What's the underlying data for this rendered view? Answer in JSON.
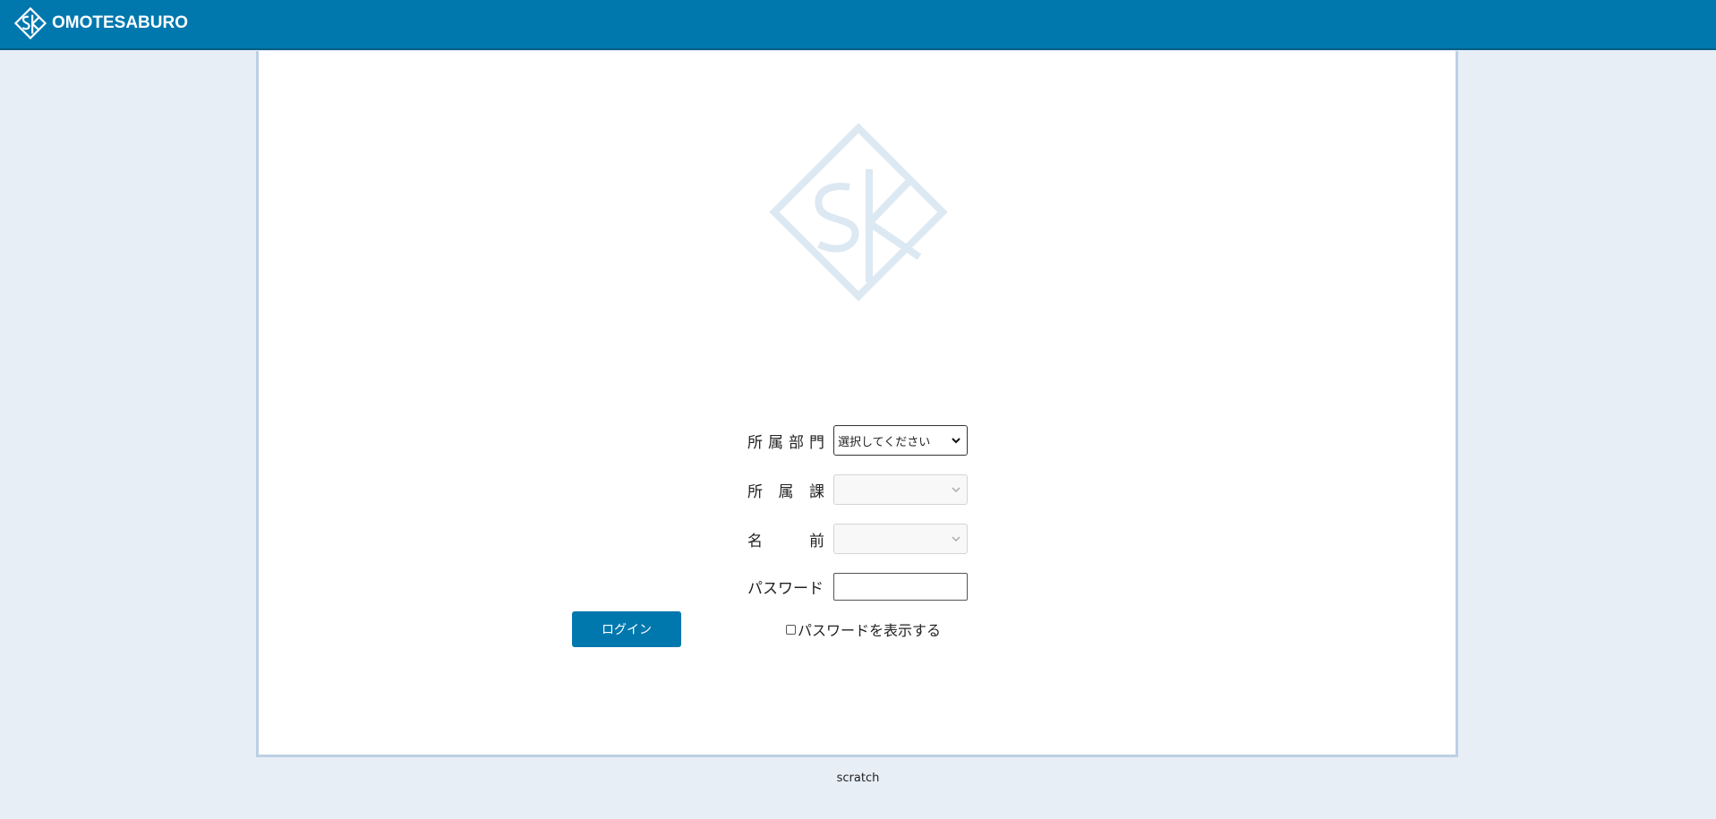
{
  "header": {
    "brand_name": "OMOTESABURO",
    "logo_icon": "sk-diamond-logo-icon",
    "background": "#0078ae"
  },
  "form": {
    "department_label": [
      "所",
      "属",
      "部",
      "門"
    ],
    "department_value": "選択してください",
    "section_label": [
      "所",
      "属",
      "課"
    ],
    "section_value": "",
    "name_label": [
      "名",
      "前"
    ],
    "name_value": "",
    "password_label": "パスワード",
    "password_value": "",
    "show_password_label": "パスワードを表示する",
    "show_password_checked": false,
    "login_label": "ログイン"
  },
  "footer": {
    "text": "scratch"
  },
  "colors": {
    "accent": "#0078ae",
    "page_bg": "#e7eef6",
    "logo_faint": "#dce8f2"
  }
}
